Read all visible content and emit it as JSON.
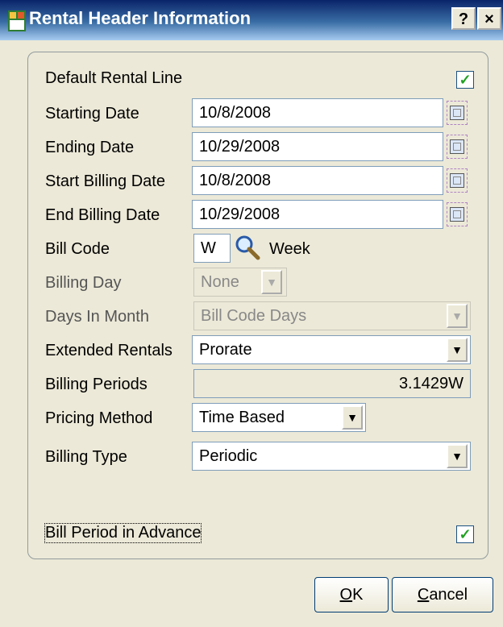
{
  "window": {
    "title": "Rental Header Information",
    "help_label": "?",
    "close_label": "×"
  },
  "form": {
    "default_rental_line": {
      "label": "Default Rental Line",
      "checked": true,
      "check_glyph": "✓"
    },
    "starting_date": {
      "label": "Starting Date",
      "value": "10/8/2008"
    },
    "ending_date": {
      "label": "Ending Date",
      "value": "10/29/2008"
    },
    "start_billing_date": {
      "label": "Start Billing Date",
      "value": "10/8/2008"
    },
    "end_billing_date": {
      "label": "End Billing Date",
      "value": "10/29/2008"
    },
    "bill_code": {
      "label": "Bill Code",
      "value": "W",
      "description": "Week"
    },
    "billing_day": {
      "label": "Billing Day",
      "value": "None"
    },
    "days_in_month": {
      "label": "Days In Month",
      "value": "Bill Code Days"
    },
    "extended_rentals": {
      "label": "Extended Rentals",
      "value": "Prorate"
    },
    "billing_periods": {
      "label": "Billing Periods",
      "value": "3.1429W"
    },
    "pricing_method": {
      "label": "Pricing Method",
      "value": "Time Based"
    },
    "billing_type": {
      "label": "Billing Type",
      "value": "Periodic"
    },
    "bill_period_in_advance": {
      "label": "Bill Period in Advance",
      "checked": true,
      "check_glyph": "✓"
    }
  },
  "buttons": {
    "ok": {
      "mnemonic": "O",
      "rest": "K"
    },
    "cancel": {
      "mnemonic": "C",
      "rest": "ancel"
    }
  },
  "dropdown_glyph": "▼",
  "colors": {
    "title_bar_dark": "#0a246a",
    "title_bar_light": "#a6caf0",
    "dialog_background": "#ece9d8",
    "checkmark_green": "#21a121"
  },
  "icons": [
    "app-icon",
    "calendar-icon",
    "search-icon",
    "dropdown-arrow-icon",
    "checkmark-icon"
  ]
}
